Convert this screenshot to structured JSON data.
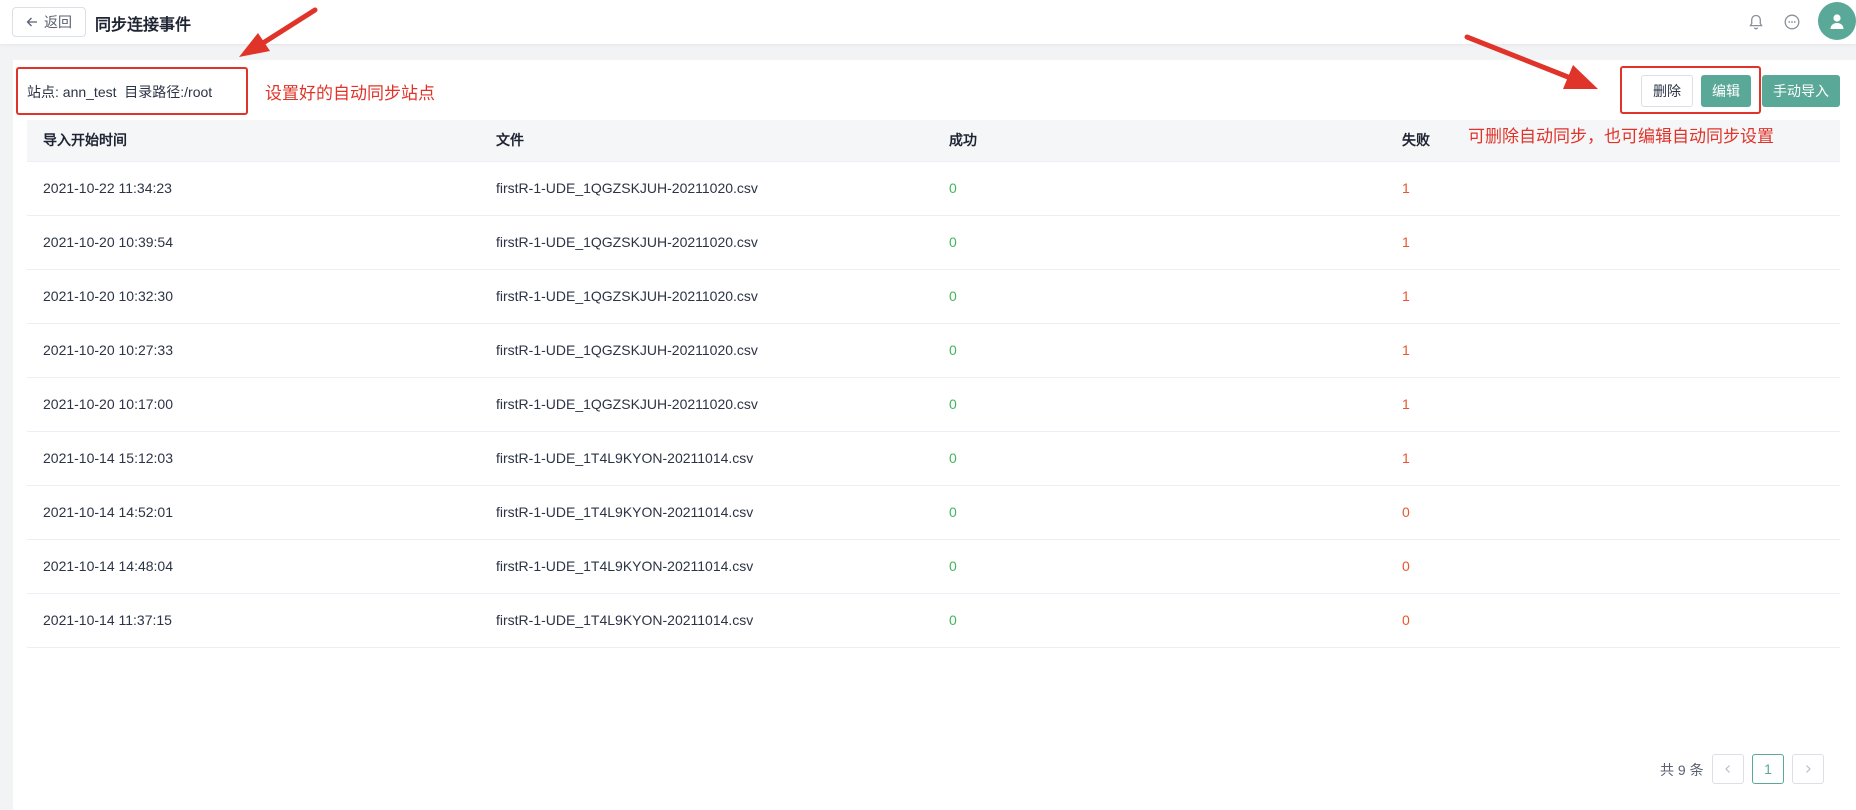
{
  "header": {
    "back_label": "返回",
    "title": "同步连接事件",
    "icons": [
      "arrow-left-icon",
      "bell-icon",
      "message-icon",
      "user-icon"
    ]
  },
  "site_info": "站点: ann_test  目录路径:/root",
  "actions": {
    "delete_label": "删除",
    "edit_label": "编辑",
    "import_label": "手动导入"
  },
  "table": {
    "columns": [
      "导入开始时间",
      "文件",
      "成功",
      "失败"
    ],
    "rows": [
      {
        "time": "2021-10-22 11:34:23",
        "file": "firstR-1-UDE_1QGZSKJUH-20211020.csv",
        "success": "0",
        "fail": "1"
      },
      {
        "time": "2021-10-20 10:39:54",
        "file": "firstR-1-UDE_1QGZSKJUH-20211020.csv",
        "success": "0",
        "fail": "1"
      },
      {
        "time": "2021-10-20 10:32:30",
        "file": "firstR-1-UDE_1QGZSKJUH-20211020.csv",
        "success": "0",
        "fail": "1"
      },
      {
        "time": "2021-10-20 10:27:33",
        "file": "firstR-1-UDE_1QGZSKJUH-20211020.csv",
        "success": "0",
        "fail": "1"
      },
      {
        "time": "2021-10-20 10:17:00",
        "file": "firstR-1-UDE_1QGZSKJUH-20211020.csv",
        "success": "0",
        "fail": "1"
      },
      {
        "time": "2021-10-14 15:12:03",
        "file": "firstR-1-UDE_1T4L9KYON-20211014.csv",
        "success": "0",
        "fail": "1"
      },
      {
        "time": "2021-10-14 14:52:01",
        "file": "firstR-1-UDE_1T4L9KYON-20211014.csv",
        "success": "0",
        "fail": "0"
      },
      {
        "time": "2021-10-14 14:48:04",
        "file": "firstR-1-UDE_1T4L9KYON-20211014.csv",
        "success": "0",
        "fail": "0"
      },
      {
        "time": "2021-10-14 11:37:15",
        "file": "firstR-1-UDE_1T4L9KYON-20211014.csv",
        "success": "0",
        "fail": "0"
      }
    ]
  },
  "pagination": {
    "total_label": "共 9 条",
    "current_page": "1",
    "icons": [
      "chevron-left-icon",
      "chevron-right-icon"
    ]
  },
  "annotations": {
    "site_note": "设置好的自动同步站点",
    "actions_note": "可删除自动同步，也可编辑自动同步设置"
  },
  "colors": {
    "accent": "#5aa897",
    "success": "#43b55c",
    "fail": "#e8562b",
    "annotation": "#e0342a"
  }
}
